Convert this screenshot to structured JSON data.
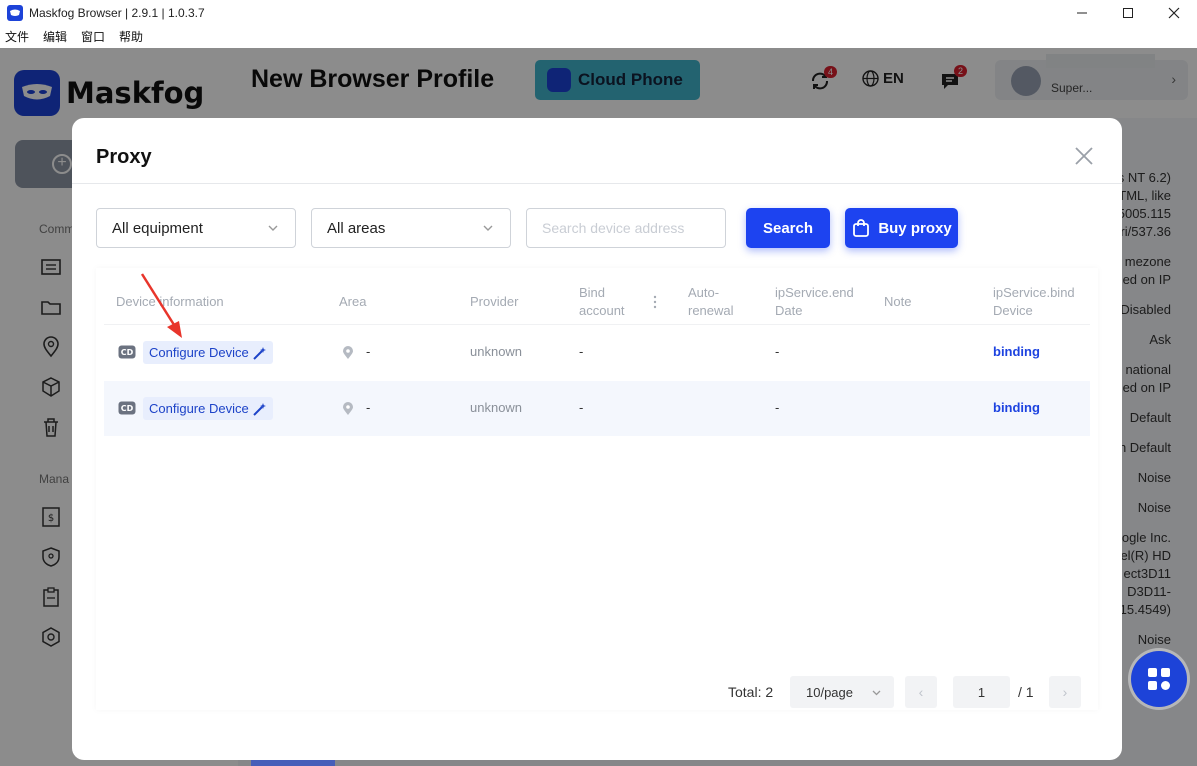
{
  "window": {
    "title": "Maskfog Browser | 2.9.1 | 1.0.3.7"
  },
  "menu": [
    "文件",
    "编辑",
    "窗口",
    "帮助"
  ],
  "app": {
    "brand": "Maskfog",
    "page_title": "New Browser Profile",
    "cloud_phone_label": "Cloud Phone",
    "sync_badge": "4",
    "language": "EN",
    "message_badge": "2",
    "user_name": "Super...",
    "sidebar_sections": [
      "Comm",
      "Mana"
    ],
    "right_panel_fragments": [
      "s NT 6.2)",
      "TML, like",
      "5005.115",
      "ri/537.36",
      "mezone",
      "ed on IP",
      "Disabled",
      "Ask",
      "national",
      "ed on IP",
      "Default",
      "n Default",
      "Noise",
      "Noise",
      "ogle Inc.",
      "el(R) HD",
      "ect3D11",
      "D3D11-",
      "15.4549)",
      "Noise"
    ]
  },
  "proxy_modal": {
    "title": "Proxy",
    "filter_equipment": "All equipment",
    "filter_area": "All areas",
    "search_placeholder": "Search device address",
    "search_label": "Search",
    "buy_label": "Buy proxy",
    "columns": {
      "device": "Device information",
      "area": "Area",
      "provider": "Provider",
      "bind_account_1": "Bind",
      "bind_account_2": "account",
      "auto_renewal_1": "Auto-",
      "auto_renewal_2": "renewal",
      "end_date_1": "ipService.end",
      "end_date_2": "Date",
      "note": "Note",
      "bind_device_1": "ipService.bind",
      "bind_device_2": "Device"
    },
    "rows": [
      {
        "device": "Configure Device",
        "area": "-",
        "provider": "unknown",
        "bind_account": "-",
        "end_date": "-",
        "bind_device": "binding"
      },
      {
        "device": "Configure Device",
        "area": "-",
        "provider": "unknown",
        "bind_account": "-",
        "end_date": "-",
        "bind_device": "binding"
      }
    ],
    "pagination": {
      "total": "Total: 2",
      "page_size": "10/page",
      "current_page": "1",
      "total_pages": "/ 1"
    }
  },
  "colors": {
    "accent": "#1d43f0",
    "link": "#1d43e0",
    "badge": "#d9202f",
    "cloud_phone": "#41b4cc"
  }
}
